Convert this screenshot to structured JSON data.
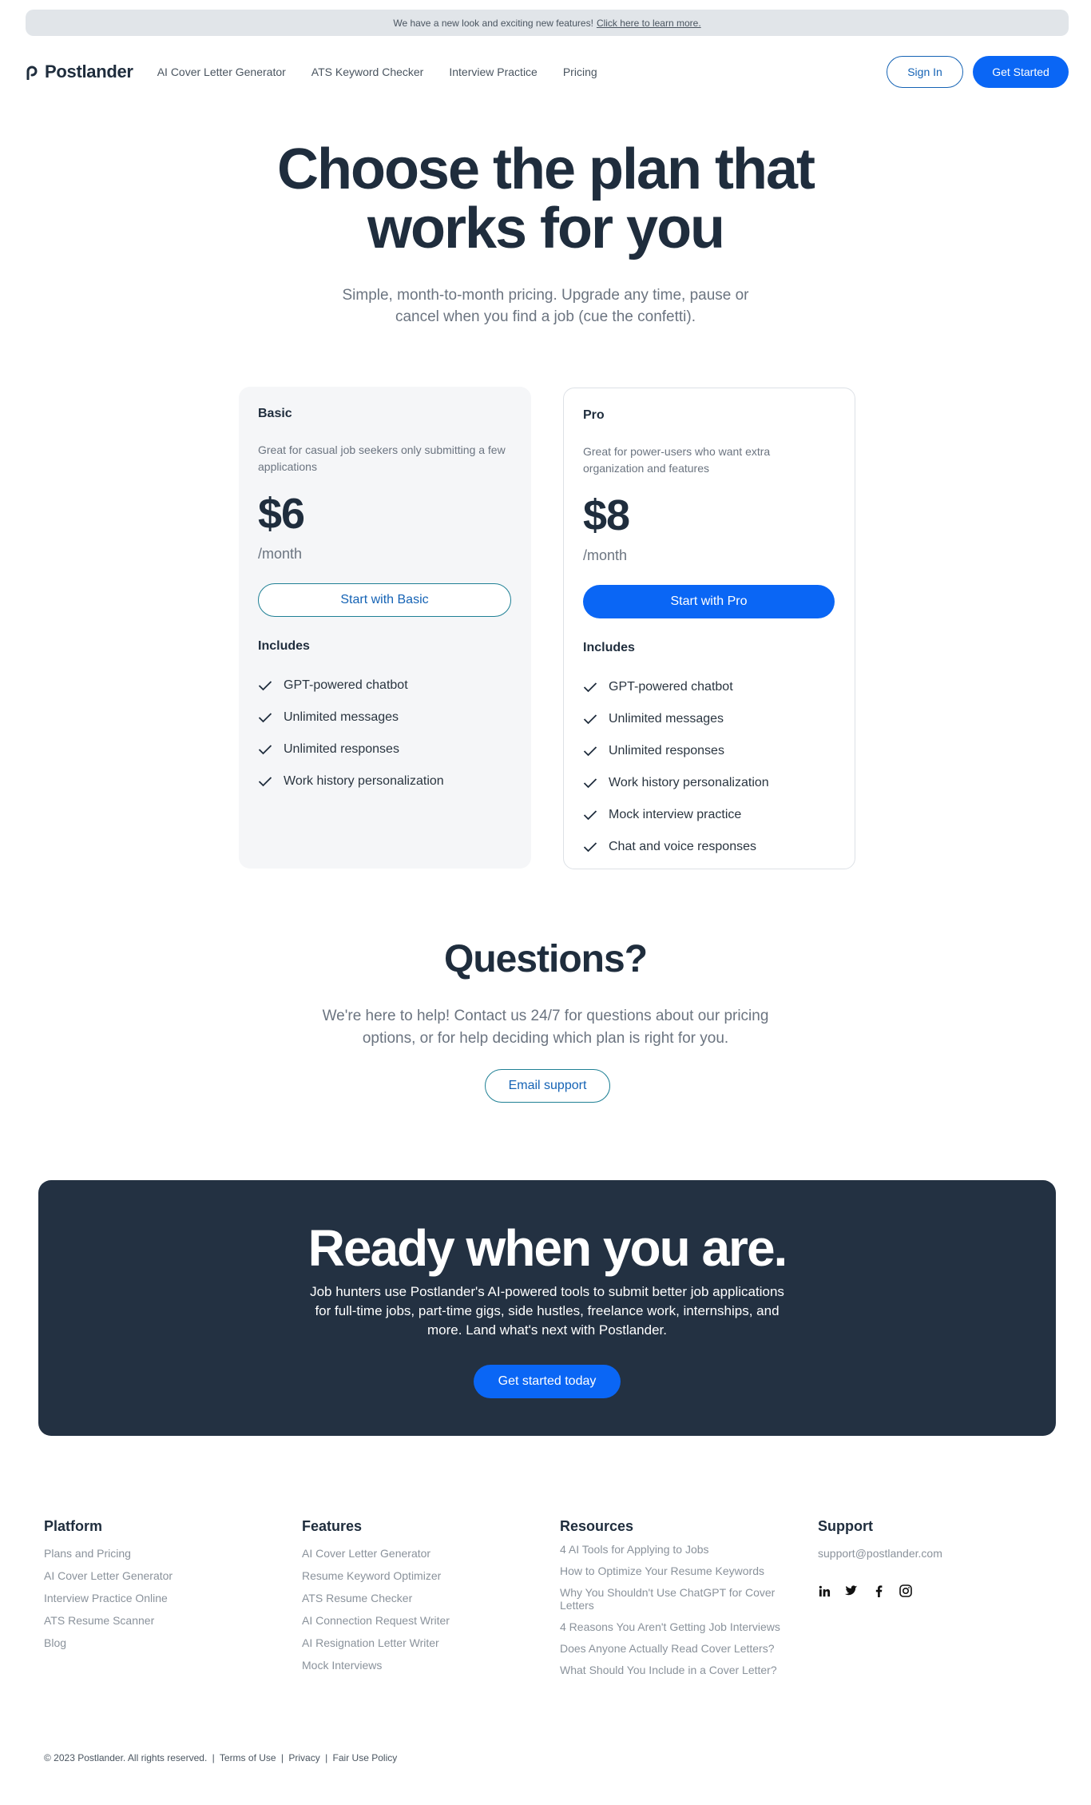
{
  "announcement": {
    "text": "We have a new look and exciting new features!",
    "link": "Click here to learn more."
  },
  "nav": {
    "logo": "Postlander",
    "links": [
      "AI Cover Letter Generator",
      "ATS Keyword Checker",
      "Interview Practice",
      "Pricing"
    ],
    "sign_in": "Sign In",
    "get_started": "Get Started"
  },
  "hero": {
    "title_line1": "Choose the plan that",
    "title_line2": "works for you",
    "subtitle": "Simple, month-to-month pricing. Upgrade any time, pause or cancel when you find a job (cue the confetti)."
  },
  "plans": [
    {
      "name": "Basic",
      "description": "Great for casual job seekers only submitting a few applications",
      "price": "$6",
      "period": "/month",
      "button": "Start with Basic",
      "includes_label": "Includes",
      "features": [
        "GPT-powered chatbot",
        "Unlimited messages",
        "Unlimited responses",
        "Work history personalization"
      ]
    },
    {
      "name": "Pro",
      "description": "Great for power-users who want extra organization and features",
      "price": "$8",
      "period": "/month",
      "button": "Start with Pro",
      "includes_label": "Includes",
      "features": [
        "GPT-powered chatbot",
        "Unlimited messages",
        "Unlimited responses",
        "Work history personalization",
        "Mock interview practice",
        "Chat and voice responses"
      ]
    }
  ],
  "questions": {
    "title": "Questions?",
    "subtitle": "We're here to help! Contact us 24/7 for questions about our pricing options, or for help deciding which plan is right for you.",
    "button": "Email support"
  },
  "cta": {
    "title": "Ready when you are.",
    "subtitle": "Job hunters use Postlander's AI-powered tools to submit better job applications for full-time jobs, part-time gigs, side hustles, freelance work, internships, and more. Land what's next with Postlander.",
    "button": "Get started today"
  },
  "footer": {
    "platform": {
      "title": "Platform",
      "links": [
        "Plans and Pricing",
        "AI Cover Letter Generator",
        "Interview Practice Online",
        "ATS Resume Scanner",
        "Blog"
      ]
    },
    "features": {
      "title": "Features",
      "links": [
        "AI Cover Letter Generator",
        "Resume Keyword Optimizer",
        "ATS Resume Checker",
        "AI Connection Request Writer",
        "AI Resignation Letter Writer",
        "Mock Interviews"
      ]
    },
    "resources": {
      "title": "Resources",
      "links": [
        "4 AI Tools for Applying to Jobs",
        "How to Optimize Your Resume Keywords",
        "Why You Shouldn't Use ChatGPT for Cover Letters",
        "4 Reasons You Aren't Getting Job Interviews",
        "Does Anyone Actually Read Cover Letters?",
        "What Should You Include in a Cover Letter?"
      ]
    },
    "support": {
      "title": "Support",
      "email": "support@postlander.com",
      "socials": [
        "linkedin-icon",
        "twitter-icon",
        "facebook-icon",
        "instagram-icon"
      ]
    },
    "copyright": "© 2023 Postlander. All rights reserved.",
    "legal": [
      "Terms of Use",
      "Privacy",
      "Fair Use Policy"
    ]
  },
  "colors": {
    "primary": "#0a66f5",
    "dark": "#1f2d3d",
    "cta_bg": "#233142",
    "muted": "#6b7480"
  }
}
